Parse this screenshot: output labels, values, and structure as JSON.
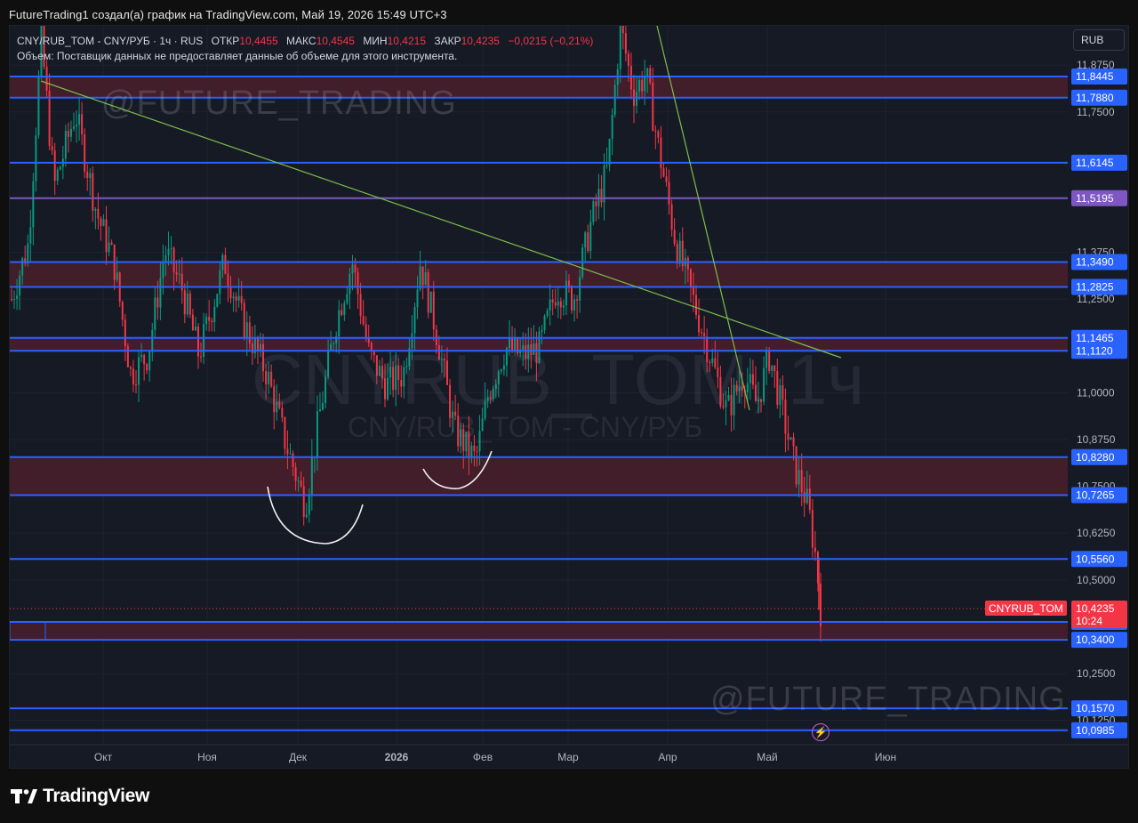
{
  "caption": "FutureTrading1 создал(а) график на TradingView.com, Май 19, 2026 15:49 UTC+3",
  "legend": {
    "symbol_info": "CNY/RUB_TOM - CNY/РУБ · 1ч · RUS",
    "open_label": "ОТКР",
    "open_value": "10,4455",
    "high_label": "МАКС",
    "high_value": "10,4545",
    "low_label": "МИН",
    "low_value": "10,4215",
    "close_label": "ЗАКР",
    "close_value": "10,4235",
    "change": "−0,0215 (−0,21%)",
    "volume_note": "Объем: Поставщик данных не предоставляет данные об объеме для этого инструмента."
  },
  "currency_button": "RUB",
  "watermarks": {
    "top": "@FUTURE_TRADING",
    "bottom": "@FUTURE_TRADING",
    "symbol": "CNYRUB_TOM, 1ч",
    "symbol_sub": "CNY/RUB_TOM - CNY/РУБ"
  },
  "logo_text": "TradingView",
  "colors": {
    "background": "#161a25",
    "grid": "#1f2330",
    "candle_up": "#089981",
    "candle_down": "#f23645",
    "zone_fill": "#4a1e2c",
    "line_blue": "#2962ff",
    "line_purple": "#7e57c2",
    "trend_green": "#7cbf4a",
    "current_price": "#f23645"
  },
  "chart_data": {
    "type": "candlestick",
    "instrument": "CNYRUB_TOM",
    "timeframe": "1ч",
    "y_ticks": [
      "11,8750",
      "11,7500",
      "11,3750",
      "11,2500",
      "11,0000",
      "10,8750",
      "10,7500",
      "10,6250",
      "10,5000",
      "10,2500",
      "10,1250"
    ],
    "y_tick_values": [
      11.875,
      11.75,
      11.375,
      11.25,
      11.0,
      10.875,
      10.75,
      10.625,
      10.5,
      10.25,
      10.125
    ],
    "x_ticks": [
      "Окт",
      "Ноя",
      "Дек",
      "2026",
      "Фев",
      "Мар",
      "Апр",
      "Май",
      "Июн"
    ],
    "ylim": [
      10.06,
      11.98
    ],
    "horizontal_levels": [
      {
        "label": "11,8445",
        "value": 11.8445,
        "color": "#2962ff"
      },
      {
        "label": "11,7880",
        "value": 11.788,
        "color": "#2962ff"
      },
      {
        "label": "11,6145",
        "value": 11.6145,
        "color": "#2962ff"
      },
      {
        "label": "11,5195",
        "value": 11.5195,
        "color": "#7e57c2"
      },
      {
        "label": "11,3490",
        "value": 11.349,
        "color": "#2962ff"
      },
      {
        "label": "11,2825",
        "value": 11.2825,
        "color": "#2962ff"
      },
      {
        "label": "11,1465",
        "value": 11.1465,
        "color": "#2962ff"
      },
      {
        "label": "11,1120",
        "value": 11.112,
        "color": "#2962ff"
      },
      {
        "label": "10,8280",
        "value": 10.828,
        "color": "#2962ff"
      },
      {
        "label": "10,7265",
        "value": 10.7265,
        "color": "#2962ff"
      },
      {
        "label": "10,5560",
        "value": 10.556,
        "color": "#2962ff"
      },
      {
        "label": "10,3880",
        "value": 10.388,
        "color": "#2962ff"
      },
      {
        "label": "10,3400",
        "value": 10.34,
        "color": "#2962ff"
      },
      {
        "label": "10,1570",
        "value": 10.157,
        "color": "#2962ff"
      },
      {
        "label": "10,0985",
        "value": 10.0985,
        "color": "#2962ff"
      }
    ],
    "zones": [
      {
        "top": 11.8445,
        "bottom": 11.788
      },
      {
        "top": 11.349,
        "bottom": 11.2825
      },
      {
        "top": 11.1465,
        "bottom": 11.112
      },
      {
        "top": 10.828,
        "bottom": 10.7265
      },
      {
        "top": 10.388,
        "bottom": 10.34
      }
    ],
    "current_price": {
      "symbol": "CNYRUB_TOM",
      "value": "10,4235",
      "countdown": "10:24",
      "price": 10.4235
    },
    "price_path": [
      [
        0.0,
        11.25
      ],
      [
        0.02,
        11.4
      ],
      [
        0.035,
        11.95
      ],
      [
        0.05,
        11.55
      ],
      [
        0.075,
        11.75
      ],
      [
        0.1,
        11.48
      ],
      [
        0.12,
        11.35
      ],
      [
        0.14,
        11.05
      ],
      [
        0.16,
        11.1
      ],
      [
        0.18,
        11.38
      ],
      [
        0.2,
        11.28
      ],
      [
        0.22,
        11.1
      ],
      [
        0.25,
        11.35
      ],
      [
        0.27,
        11.2
      ],
      [
        0.3,
        11.05
      ],
      [
        0.32,
        10.88
      ],
      [
        0.345,
        10.7
      ],
      [
        0.36,
        10.92
      ],
      [
        0.38,
        11.18
      ],
      [
        0.4,
        11.35
      ],
      [
        0.42,
        11.1
      ],
      [
        0.44,
        11.02
      ],
      [
        0.46,
        11.05
      ],
      [
        0.48,
        11.35
      ],
      [
        0.5,
        11.15
      ],
      [
        0.52,
        10.9
      ],
      [
        0.545,
        10.82
      ],
      [
        0.56,
        11.0
      ],
      [
        0.58,
        11.12
      ],
      [
        0.6,
        11.1
      ],
      [
        0.62,
        11.12
      ],
      [
        0.64,
        11.28
      ],
      [
        0.66,
        11.25
      ],
      [
        0.68,
        11.45
      ],
      [
        0.7,
        11.6
      ],
      [
        0.715,
        11.98
      ],
      [
        0.73,
        11.8
      ],
      [
        0.745,
        11.85
      ],
      [
        0.76,
        11.65
      ],
      [
        0.78,
        11.4
      ],
      [
        0.8,
        11.25
      ],
      [
        0.82,
        11.1
      ],
      [
        0.84,
        10.95
      ],
      [
        0.86,
        11.05
      ],
      [
        0.875,
        10.97
      ],
      [
        0.89,
        11.1
      ],
      [
        0.905,
        10.95
      ],
      [
        0.92,
        10.8
      ],
      [
        0.935,
        10.7
      ],
      [
        0.945,
        10.55
      ],
      [
        0.95,
        10.42
      ]
    ]
  }
}
